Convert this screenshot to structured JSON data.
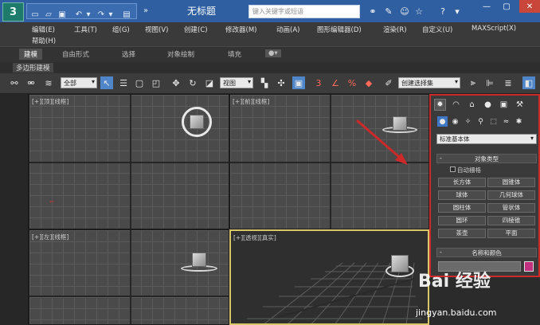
{
  "window": {
    "title": "无标题",
    "search_placeholder": "键入关键字或短语",
    "help_label": "?"
  },
  "menu": {
    "row1": [
      "编辑(E)",
      "工具(T)",
      "组(G)",
      "视图(V)",
      "创建(C)",
      "修改器(M)",
      "动画(A)",
      "图形编辑器(D)",
      "渲染(R)",
      "自定义(U)",
      "MAXScript(X)"
    ],
    "row2": [
      "帮助(H)"
    ]
  },
  "ribbon": {
    "tabs": [
      "建模",
      "自由形式",
      "选择",
      "对象绘制",
      "填充"
    ],
    "active_tab": "建模",
    "sub_label": "多边形建模"
  },
  "toolbar": {
    "selection_filter": "全部",
    "reference_coord": "视图",
    "named_selection": "创建选择集"
  },
  "viewports": {
    "top": "[+][顶][线框]",
    "front": "[+][前][线框]",
    "left": "[+][左][线框]",
    "perspective": "[+][透视][真实]"
  },
  "command_panel": {
    "tabs": [
      "create-icon",
      "modify-icon",
      "hierarchy-icon",
      "motion-icon",
      "display-icon",
      "utilities-icon"
    ],
    "category": "标准基本体",
    "object_type_title": "对象类型",
    "autogrid_label": "自动栅格",
    "objects": [
      "长方体",
      "圆锥体",
      "球体",
      "几何球体",
      "圆柱体",
      "管状体",
      "圆环",
      "四棱锥",
      "茶壶",
      "平面"
    ],
    "name_color_title": "名称和颜色",
    "swatch_color": "#c2317f"
  },
  "watermark": {
    "logo": "Bai 经验",
    "url": "jingyan.baidu.com"
  },
  "colors": {
    "annotation_red": "#cc2a2a",
    "titlebar_blue": "#2f5fa0",
    "active_viewport_border": "#d9c56a"
  }
}
